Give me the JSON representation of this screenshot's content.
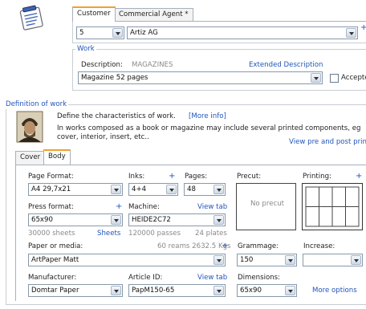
{
  "header": {
    "tabs": [
      {
        "label": "Customer",
        "active": true
      },
      {
        "label": "Commercial Agent *",
        "active": false
      }
    ],
    "customer_code": "5",
    "customer_name": "Artiz AG",
    "plus": "+"
  },
  "work": {
    "legend": "Work",
    "description_label": "Description:",
    "description_value": "MAGAZINES",
    "extended_link": "Extended Description",
    "work_select": "Magazine 52 pages",
    "accept_label": "Accepte"
  },
  "definition": {
    "legend": "Definition of work",
    "intro": "Define the characteristics of work.",
    "more_info": "[More info]",
    "desc_line1": "In works composed as a book or magazine may include several printed components, eg",
    "desc_line2": "cover, interior, insert, etc..",
    "pre_post_link": "View pre and post print",
    "tabs": [
      {
        "label": "Cover",
        "active": false
      },
      {
        "label": "Body",
        "active": true
      }
    ]
  },
  "form": {
    "page_format_label": "Page Format:",
    "page_format_value": "A4 29,7x21",
    "inks_label": "Inks:",
    "inks_value": "4+4",
    "pages_label": "Pages:",
    "pages_value": "48",
    "precut_label": "Precut:",
    "no_precut": "No precut",
    "printing_label": "Printing:",
    "press_format_label": "Press format:",
    "press_format_value": "65x90",
    "machine_label": "Machine:",
    "machine_value": "HEIDE2C72",
    "view_tab": "View tab",
    "sheets_text": "30000 sheets",
    "sheets_link": "Sheets",
    "passes_text": "120000 passes",
    "plates_text": "24 plates",
    "paper_label": "Paper or media:",
    "reams_text": "60 reams 2632.5 Kgs",
    "paper_value": "ArtPaper Matt",
    "grammage_label": "Grammage:",
    "grammage_value": "150",
    "increase_label": "Increase:",
    "increase_value": "",
    "manufacturer_label": "Manufacturer:",
    "manufacturer_value": "Domtar Paper",
    "article_label": "Article ID:",
    "article_value": "PapM150-65",
    "view_tab_2": "View tab",
    "dimensions_label": "Dimensions:",
    "dimensions_value": "65x90",
    "more_options": "More options",
    "plus": "+"
  },
  "colors": {
    "accent": "#2255bb",
    "tab_highlight": "#f0a030",
    "frame": "#c8cdd3"
  }
}
